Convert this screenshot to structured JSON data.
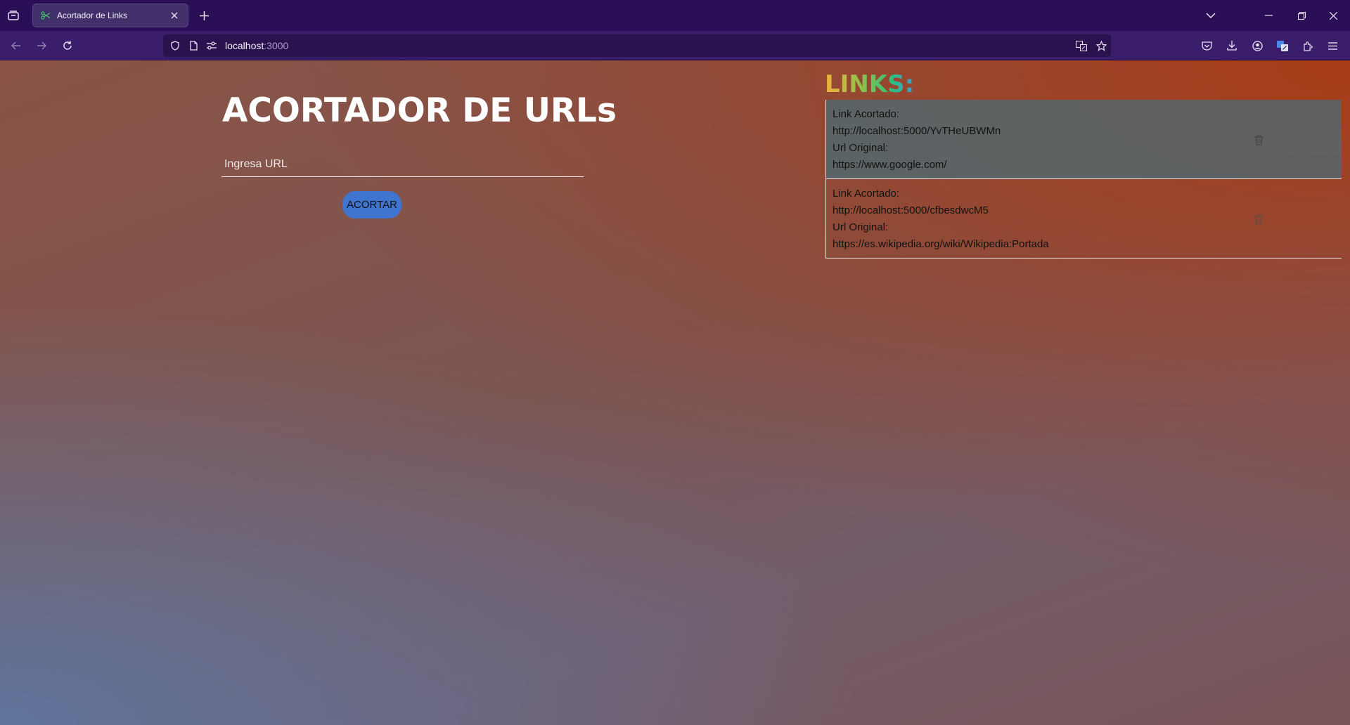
{
  "browser": {
    "tab_title": "Acortador de Links",
    "url_host": "localhost",
    "url_port": ":3000"
  },
  "page": {
    "title": "ACORTADOR DE URLs",
    "input_placeholder": "Ingresa URL",
    "button_label": "ACORTAR",
    "links_heading": "LINKS:"
  },
  "links": [
    {
      "short_label": "Link Acortado:",
      "short_url": "http://localhost:5000/YvTHeUBWMn",
      "original_label": "Url Original:",
      "original_url": "https://www.google.com/"
    },
    {
      "short_label": "Link Acortado:",
      "short_url": "http://localhost:5000/cfbesdwcM5",
      "original_label": "Url Original:",
      "original_url": "https://es.wikipedia.org/wiki/Wikipedia:Portada"
    }
  ],
  "colors": {
    "button": "#3f74cf",
    "active_card": "#466e78",
    "chrome_bg": "#2a0f57"
  }
}
